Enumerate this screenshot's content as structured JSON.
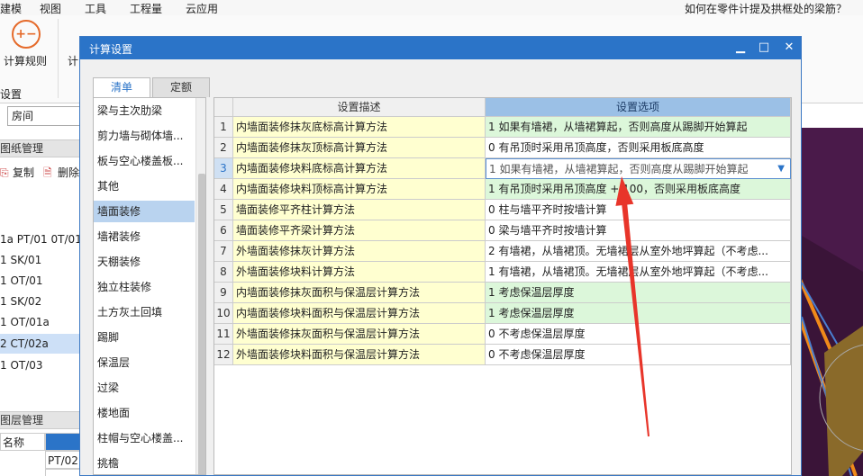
{
  "menubar": {
    "items": [
      "建模",
      "视图",
      "工具",
      "工程量",
      "云应用"
    ]
  },
  "ribbon": {
    "calc_rules": "计算规则",
    "calc_partial": "计",
    "group_label": "设置",
    "hint": "如何在零件计提及拱框处的梁筋？"
  },
  "left_panel": {
    "combo_value": "房间",
    "drawing_mgmt": "图纸管理",
    "copy_label": "复制",
    "delete_label": "删除",
    "items": [
      "1a PT/01 0T/01",
      "1 SK/01",
      "1 OT/01",
      "1 SK/02",
      "1 OT/01a",
      "2 CT/02a",
      "1 OT/03"
    ],
    "selected_index": 5,
    "layer_mgmt": "图层管理",
    "col_name": "名称",
    "cell_value": "PT/02"
  },
  "dialog": {
    "title": "计算设置",
    "tabs": [
      "清单",
      "定额"
    ],
    "active_tab": 0,
    "categories": [
      "梁与主次肋梁",
      "剪力墙与砌体墙...",
      "板与空心楼盖板...",
      "其他",
      "墙面装修",
      "墙裙装修",
      "天棚装修",
      "独立柱装修",
      "土方灰土回填",
      "踢脚",
      "保温层",
      "过梁",
      "楼地面",
      "柱帽与空心楼盖...",
      "挑檐"
    ],
    "selected_category": 4,
    "grid": {
      "header_desc": "设置描述",
      "header_option": "设置选项",
      "current_row": 3,
      "rows": [
        {
          "num": "1",
          "desc": "内墙面装修抹灰底标高计算方法",
          "value": "1 如果有墙裙，从墙裙算起，否则高度从踢脚开始算起",
          "green": true
        },
        {
          "num": "2",
          "desc": "内墙面装修抹灰顶标高计算方法",
          "value": "0 有吊顶时采用吊顶高度，否则采用板底高度",
          "green": false
        },
        {
          "num": "3",
          "desc": "内墙面装修块料底标高计算方法",
          "value": "1 如果有墙裙，从墙裙算起，否则高度从踢脚开始算起",
          "green": false
        },
        {
          "num": "4",
          "desc": "内墙面装修块料顶标高计算方法",
          "value": "1 有吊顶时采用吊顶高度 + 100，否则采用板底高度",
          "green": true
        },
        {
          "num": "5",
          "desc": "墙面装修平齐柱计算方法",
          "value": "0 柱与墙平齐时按墙计算",
          "green": false
        },
        {
          "num": "6",
          "desc": "墙面装修平齐梁计算方法",
          "value": "0 梁与墙平齐时按墙计算",
          "green": false
        },
        {
          "num": "7",
          "desc": "外墙面装修抹灰计算方法",
          "value": "2 有墙裙，从墙裙顶。无墙裙层从室外地坪算起（不考虑...",
          "green": false
        },
        {
          "num": "8",
          "desc": "外墙面装修块料计算方法",
          "value": "1 有墙裙，从墙裙顶。无墙裙层从室外地坪算起（不考虑...",
          "green": false
        },
        {
          "num": "9",
          "desc": "内墙面装修抹灰面积与保温层计算方法",
          "value": "1 考虑保温层厚度",
          "green": true
        },
        {
          "num": "10",
          "desc": "内墙面装修块料面积与保温层计算方法",
          "value": "1 考虑保温层厚度",
          "green": true
        },
        {
          "num": "11",
          "desc": "外墙面装修抹灰面积与保温层计算方法",
          "value": "0 不考虑保温层厚度",
          "green": false
        },
        {
          "num": "12",
          "desc": "外墙面装修块料面积与保温层计算方法",
          "value": "0 不考虑保温层厚度",
          "green": false
        }
      ]
    }
  },
  "colors": {
    "title_bar": "#2b74c8",
    "desc_bg": "#ffffd0",
    "green_bg": "#dcf7da",
    "header_option": "#9bc0e6",
    "annotation_arrow": "#e8352a"
  }
}
